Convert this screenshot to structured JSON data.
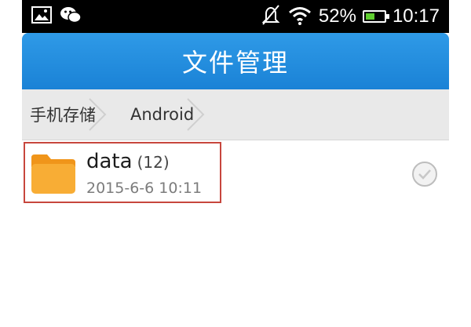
{
  "status_bar": {
    "battery_percent": "52%",
    "time": "10:17",
    "battery_level": 0.52,
    "icons": [
      "gallery-icon",
      "wechat-icon",
      "bell-muted-icon",
      "wifi-icon"
    ]
  },
  "header": {
    "title": "文件管理"
  },
  "breadcrumb": {
    "items": [
      {
        "label": "手机存储"
      },
      {
        "label": "Android"
      }
    ]
  },
  "files": [
    {
      "name": "data",
      "count": "(12)",
      "date": "2015-6-6 10:11",
      "icon": "folder-icon",
      "selected_highlight_color": "#c7463d"
    }
  ],
  "colors": {
    "title_bar": "#1a82d6",
    "breadcrumb_bg": "#e9e9e9",
    "folder": "#f6a623"
  }
}
